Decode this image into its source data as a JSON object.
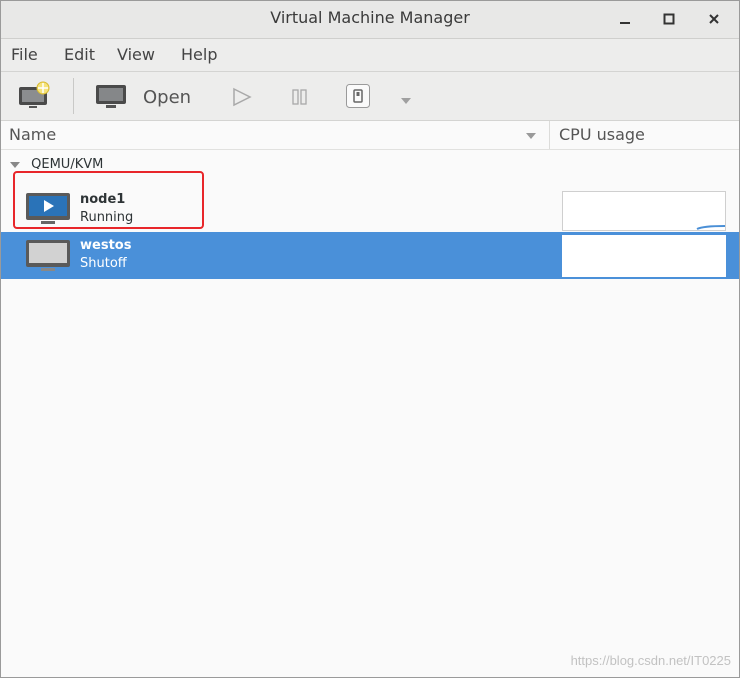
{
  "window": {
    "title": "Virtual Machine Manager",
    "controls": {
      "minimize": "_",
      "maximize": "□",
      "close": "×"
    }
  },
  "menu": [
    "File",
    "Edit",
    "View",
    "Help"
  ],
  "toolbar": {
    "new_vm_icon": "new-vm-icon",
    "open_label": "Open",
    "icons": [
      "monitor-icon",
      "play-icon",
      "pause-icon",
      "shutdown-icon",
      "dropdown-arrow-icon"
    ]
  },
  "list": {
    "columns": {
      "name": "Name",
      "cpu": "CPU usage"
    },
    "group": "QEMU/KVM",
    "vms": [
      {
        "name": "node1",
        "status": "Running",
        "selected": false
      },
      {
        "name": "westos",
        "status": "Shutoff",
        "selected": true
      }
    ]
  },
  "annotation_color": "#e8262a",
  "selection_color": "#4a90d9",
  "watermark": "https://blog.csdn.net/IT0225"
}
